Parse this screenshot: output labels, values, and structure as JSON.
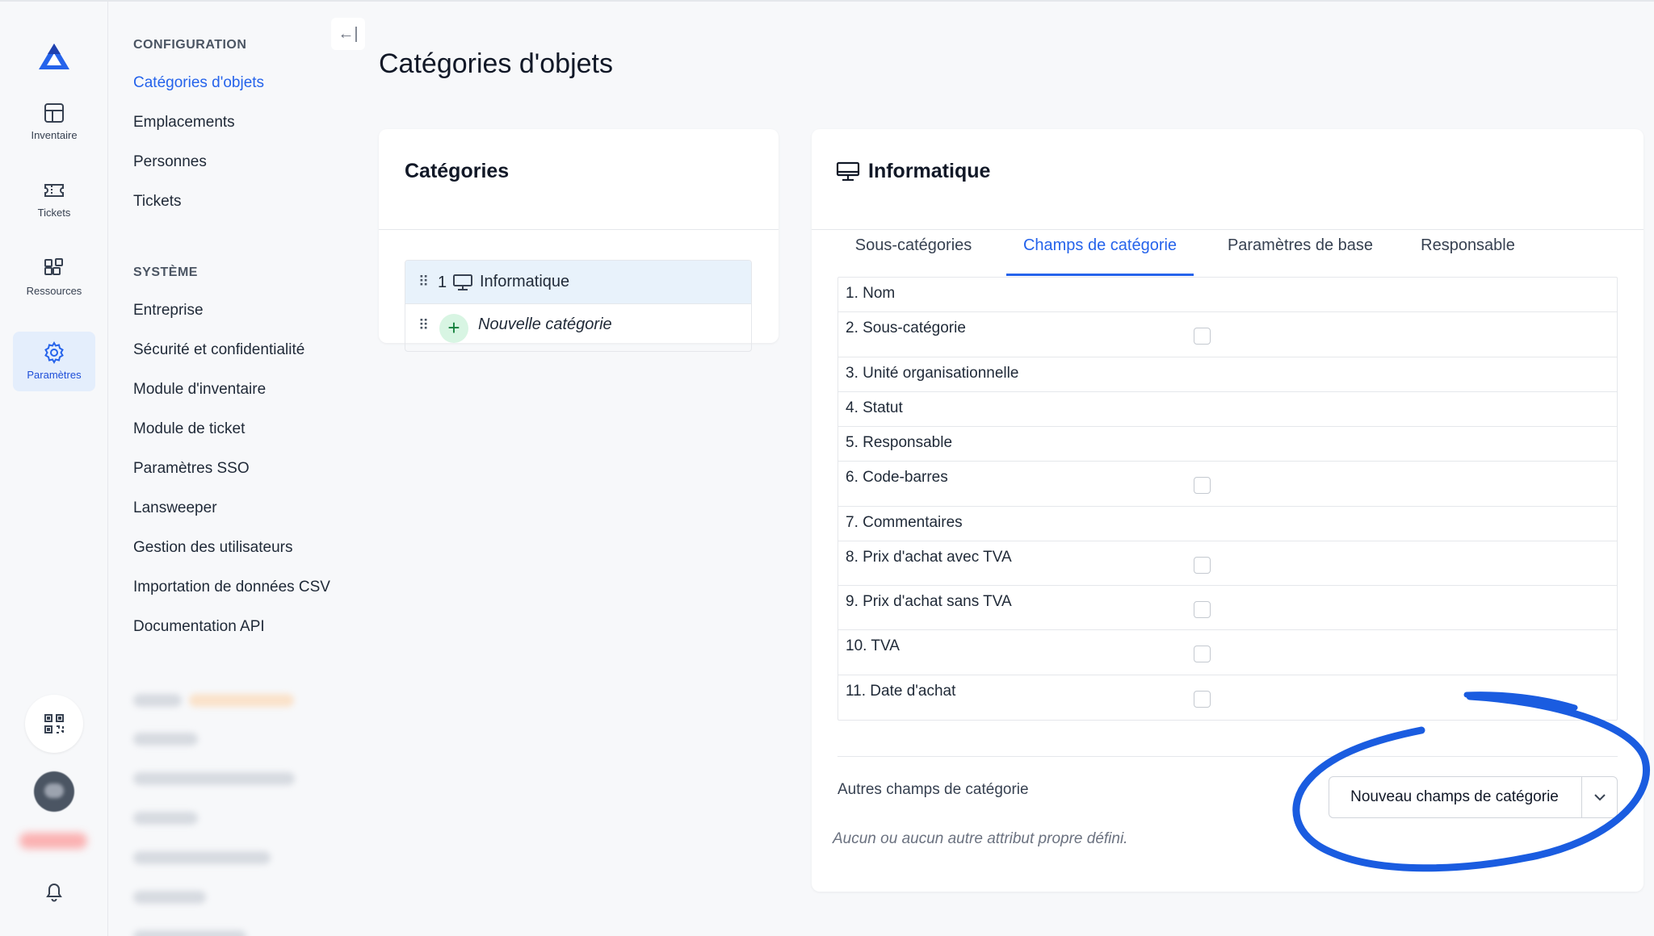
{
  "rail": {
    "items": [
      {
        "label": "Inventaire"
      },
      {
        "label": "Tickets"
      },
      {
        "label": "Ressources"
      },
      {
        "label": "Paramètres"
      }
    ],
    "icons": [
      "logo-icon",
      "inventory-icon",
      "ticket-icon",
      "resources-icon",
      "settings-icon",
      "qr-code-icon",
      "bell-icon"
    ],
    "accent": "#2563eb"
  },
  "sidebar": {
    "collapse_glyph": "←|",
    "config_heading": "CONFIGURATION",
    "config_items": [
      "Catégories d'objets",
      "Emplacements",
      "Personnes",
      "Tickets"
    ],
    "system_heading": "SYSTÈME",
    "system_items": [
      "Entreprise",
      "Sécurité et confidentialité",
      "Module d'inventaire",
      "Module de ticket",
      "Paramètres SSO",
      "Lansweeper",
      "Gestion des utilisateurs",
      "Importation de données CSV",
      "Documentation API"
    ],
    "active_item": "Catégories d'objets"
  },
  "page": {
    "title": "Catégories d'objets"
  },
  "categories_card": {
    "title": "Catégories",
    "grip": "⠿",
    "selected": {
      "number": "1",
      "name": "Informatique"
    },
    "new_label": "Nouvelle catégorie",
    "plus": "+"
  },
  "detail_card": {
    "title": "Informatique",
    "tabs": [
      "Sous-catégories",
      "Champs de catégorie",
      "Paramètres de base",
      "Responsable"
    ],
    "active_tab": "Champs de catégorie",
    "fields": [
      {
        "label": "1. Nom",
        "checkbox": false
      },
      {
        "label": "2. Sous-catégorie",
        "checkbox": true
      },
      {
        "label": "3. Unité organisationnelle",
        "checkbox": false
      },
      {
        "label": "4. Statut",
        "checkbox": false
      },
      {
        "label": "5. Responsable",
        "checkbox": false
      },
      {
        "label": "6. Code-barres",
        "checkbox": true
      },
      {
        "label": "7. Commentaires",
        "checkbox": false
      },
      {
        "label": "8. Prix d'achat avec TVA",
        "checkbox": true
      },
      {
        "label": "9. Prix d'achat sans TVA",
        "checkbox": true
      },
      {
        "label": "10. TVA",
        "checkbox": true
      },
      {
        "label": "11. Date d'achat",
        "checkbox": true
      }
    ],
    "other_fields_label": "Autres champs de catégorie",
    "empty_text": "Aucun ou aucun autre attribut propre défini.",
    "new_field_button": "Nouveau champs de catégorie"
  },
  "annotation_color": "#1a5ce0"
}
